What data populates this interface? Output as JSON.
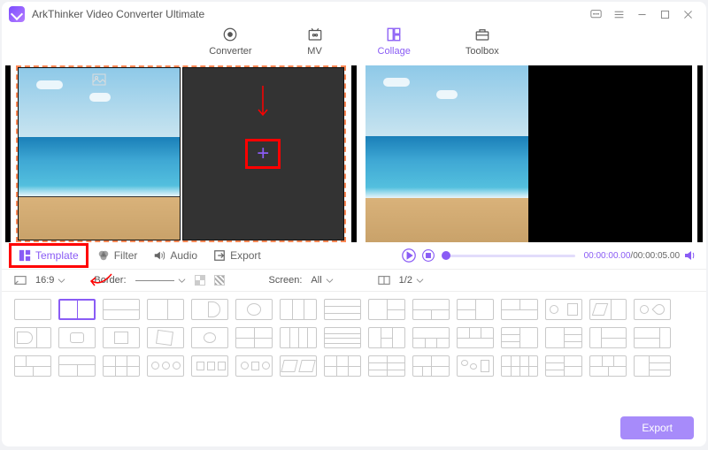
{
  "title": "ArkThinker Video Converter Ultimate",
  "nav": {
    "converter": "Converter",
    "mv": "MV",
    "collage": "Collage",
    "toolbox": "Toolbox"
  },
  "tabs": {
    "template": "Template",
    "filter": "Filter",
    "audio": "Audio",
    "export": "Export"
  },
  "options": {
    "aspect": "16:9",
    "border_label": "Border:",
    "screen_label": "Screen:",
    "screen_value": "All",
    "split_value": "1/2"
  },
  "playback": {
    "current": "00:00:00.00",
    "total": "00:00:05.00"
  },
  "footer": {
    "export": "Export"
  }
}
